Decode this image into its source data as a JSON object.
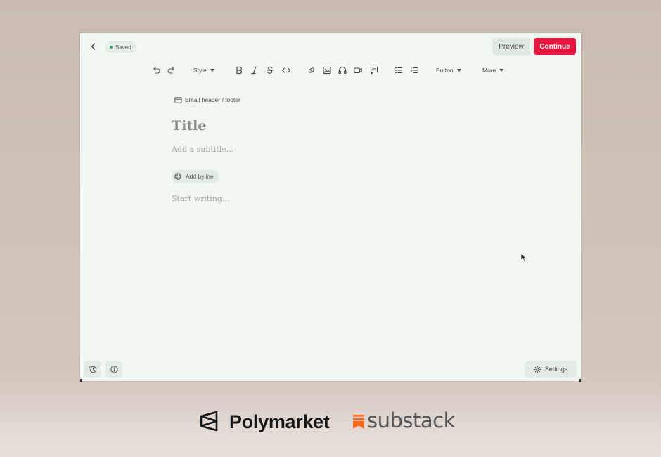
{
  "topbar": {
    "saved_label": "Saved",
    "preview_label": "Preview",
    "continue_label": "Continue"
  },
  "toolbar": {
    "style_label": "Style",
    "button_label": "Button",
    "more_label": "More",
    "icons": [
      "undo-icon",
      "redo-icon",
      "bold-icon",
      "italic-icon",
      "strikethrough-icon",
      "code-icon",
      "link-icon",
      "image-icon",
      "audio-icon",
      "video-icon",
      "comment-icon",
      "bulleted-list-icon",
      "numbered-list-icon"
    ]
  },
  "editor": {
    "email_header_footer_label": "Email header / footer",
    "title_placeholder": "Title",
    "subtitle_placeholder": "Add a subtitle...",
    "byline_label": "Add byline",
    "body_placeholder": "Start writing..."
  },
  "footer": {
    "settings_label": "Settings"
  },
  "branding": {
    "polymarket": "Polymarket",
    "substack": "substack"
  },
  "colors": {
    "accent": "#e5163f",
    "editor_bg": "#f1f8f2",
    "saved_dot": "#3aa36a",
    "substack_orange": "#ff6719"
  }
}
